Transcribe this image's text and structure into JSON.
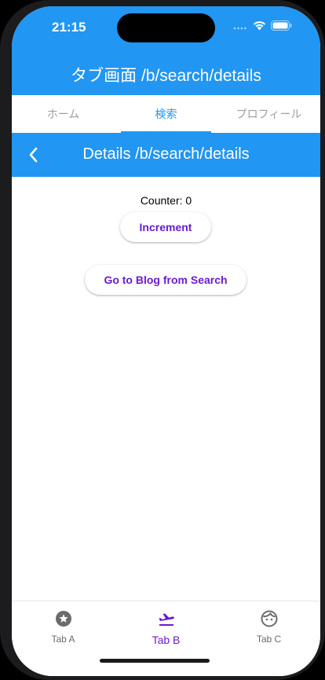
{
  "status_bar": {
    "time": "21:15"
  },
  "app_bar": {
    "title": "タブ画面 /b/search/details"
  },
  "tabs": [
    {
      "label": "ホーム",
      "active": false
    },
    {
      "label": "検索",
      "active": true
    },
    {
      "label": "プロフィール",
      "active": false
    }
  ],
  "details": {
    "title": "Details /b/search/details",
    "counter_text": "Counter: 0",
    "increment_label": "Increment",
    "blog_button_label": "Go to Blog from Search"
  },
  "bottom_nav": {
    "items": [
      {
        "label": "Tab A",
        "icon": "star-circle-icon",
        "active": false
      },
      {
        "label": "Tab B",
        "icon": "flight-takeoff-icon",
        "active": true
      },
      {
        "label": "Tab C",
        "icon": "face-icon",
        "active": false
      }
    ]
  },
  "colors": {
    "primary": "#2196f3",
    "accent_text": "#6a1bcf",
    "inactive": "#9e9e9e"
  }
}
